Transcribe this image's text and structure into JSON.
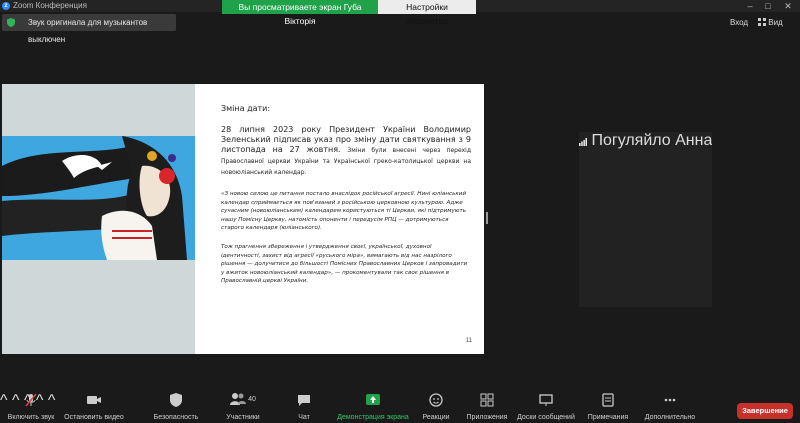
{
  "window": {
    "app_title": "Zoom Конференция"
  },
  "share": {
    "viewing_text": "Вы просматриваете экран Губа Вікторія",
    "view_settings": "Настройки просмотра"
  },
  "notice": {
    "audio_text": "Звук оригинала для музыкантов выключен"
  },
  "top_right": {
    "exit": "Вход",
    "view": "Вид"
  },
  "slide": {
    "heading": "Зміна дати:",
    "lead_main": "28 липня 2023 року Президент України Володимир Зеленський підписав указ про зміну дати святкування з 9 листопада на 27 жовтня.",
    "lead_rest": "Зміни були внесені через перехід Православної церкви України та Української греко-католицької церкви на новоюліанський календар.",
    "quote": "«З новою силою це питання постало внаслідок російської агресії. Нині юліанський календар сприймається як пов'язаний з російською церковною культурою. Адже сучасним (новоюліанським) календарем користуються ті Церкви, які підтримують нашу Помісну Церкву, натомість опоненти і передусім РПЦ — дотримуються старого календаря (юліанського).",
    "closing": "Тож прагнення збереження і утвердження своєї, української, духовної ідентичності, захист від агресії «руського міра», вимагають від нас назрілого рішення — долучитися до більшості Помісних Православних Церков і запровадити у вжиток новоюліанський календар», — прокоментували так своє рішення в Православній церкві України.",
    "page_number": "11"
  },
  "participant": {
    "name": "Погуляйло Анна"
  },
  "toolbar": {
    "mute": "Включить звук",
    "video": "Остановить видео",
    "security": "Безопасность",
    "participants": "Участники",
    "participants_count": "40",
    "chat": "Чат",
    "share_screen": "Демонстрация экрана",
    "reactions": "Реакции",
    "apps": "Приложения",
    "whiteboards": "Доски сообщений",
    "notes": "Примечания",
    "more": "Дополнительно",
    "end": "Завершение"
  },
  "colors": {
    "share_green": "#1fa24a",
    "end_red": "#c6322b",
    "zoom_blue": "#2d8cff"
  }
}
